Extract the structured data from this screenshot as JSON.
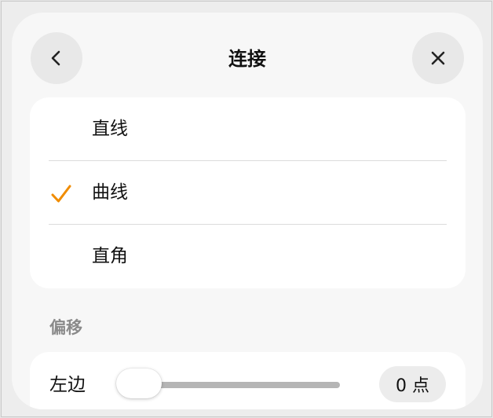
{
  "header": {
    "title": "连接",
    "back_icon": "chevron-left-icon",
    "close_icon": "close-icon"
  },
  "connection_options": {
    "selected": "曲线",
    "check_color": "#f08c00",
    "items": [
      {
        "label": "直线",
        "checked": false
      },
      {
        "label": "曲线",
        "checked": true
      },
      {
        "label": "直角",
        "checked": false
      }
    ]
  },
  "offset_section": {
    "title": "偏移",
    "slider": {
      "label": "左边",
      "value": 0,
      "value_text": "0 点"
    }
  }
}
